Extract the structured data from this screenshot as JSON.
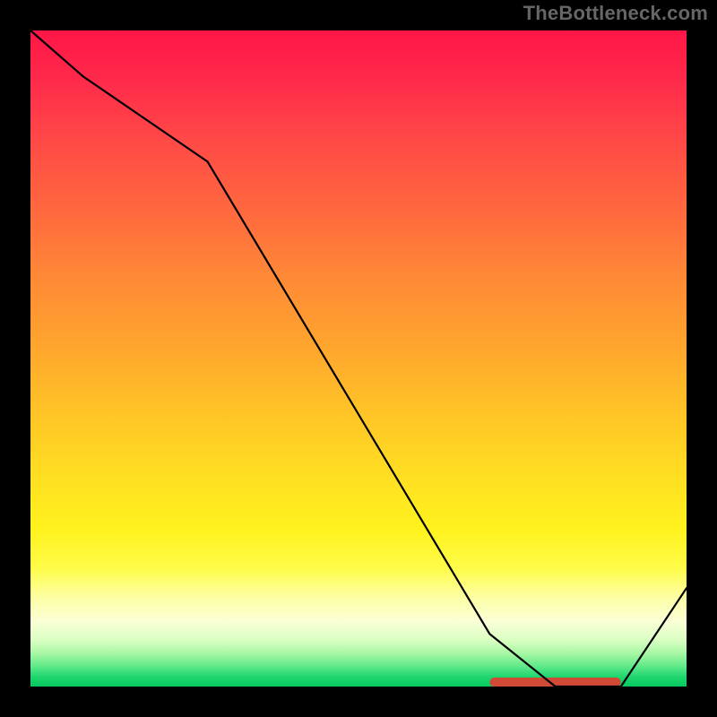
{
  "attribution": "TheBottleneck.com",
  "chart_data": {
    "type": "line",
    "title": "",
    "xlabel": "",
    "ylabel": "",
    "xlim": [
      0,
      100
    ],
    "ylim": [
      0,
      100
    ],
    "series": [
      {
        "name": "curve",
        "x": [
          0,
          8,
          27,
          70,
          80,
          90,
          100
        ],
        "values": [
          100,
          93,
          80,
          8,
          0,
          0,
          15
        ]
      }
    ],
    "background": {
      "type": "vertical-gradient",
      "stops": [
        {
          "pos": 0,
          "color": "#ff1647"
        },
        {
          "pos": 0.5,
          "color": "#ffb028"
        },
        {
          "pos": 0.8,
          "color": "#fff21e"
        },
        {
          "pos": 0.93,
          "color": "#d9ffc2"
        },
        {
          "pos": 1.0,
          "color": "#07c95f"
        }
      ]
    },
    "annotations": [
      {
        "name": "baseline-marker",
        "shape": "rounded-bar",
        "color": "#d04a36",
        "x_start": 70,
        "x_end": 90,
        "y": 0
      }
    ]
  }
}
